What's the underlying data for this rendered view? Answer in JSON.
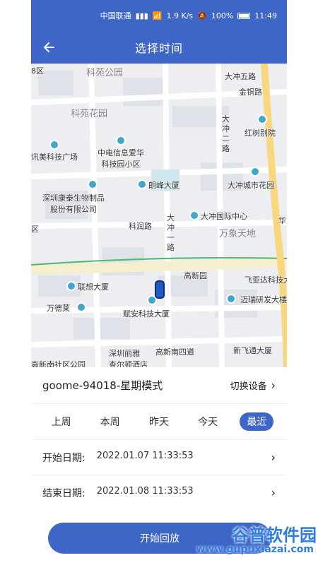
{
  "statusbar": {
    "carrier": "中国联通",
    "speed": "1.9 K/s",
    "battery": "100%",
    "time": "11:49"
  },
  "appbar": {
    "title": "选择时间"
  },
  "map": {
    "labels": {
      "keyuan_park": "科苑公园",
      "dachong5": "大冲五路",
      "jintong": "金铜路",
      "keyuan_garden": "科苑花园",
      "dachong2": "大冲二路",
      "honshu": "红树别院",
      "xunmei": "讯美科技广场",
      "zhongdian": "中电信息爱华\n科技园小区",
      "langfeng": "朗峰大厦",
      "dachong_city": "大冲城市花园",
      "kangtai": "深圳康泰生物制品\n股份有限公司",
      "dachong_intl": "大冲国际中心",
      "kerun": "科润路",
      "dachong1": "大冲一路",
      "wanxiang": "万象天地",
      "gaoxinyuan": "高新园",
      "lenovo": "联想大厦",
      "feiyada": "飞亚达科技大",
      "wandelai": "万德莱",
      "fuan": "赋安科技大厦",
      "maixun": "迈瑞研发大楼",
      "shenzhen_liya": "深圳丽雅\n查尔顿酒店",
      "gaoxin4": "高新南四道",
      "xinfeitong": "新飞通大厦",
      "gaoxin_south": "高新南社区公园",
      "edge_top_left": "8区",
      "edge_mid_left": "区",
      "edge_hua": "华"
    }
  },
  "device": {
    "name": "goome-94018-星期模式",
    "switch_label": "切换设备"
  },
  "tabs": [
    {
      "label": "上周"
    },
    {
      "label": "本周"
    },
    {
      "label": "昨天"
    },
    {
      "label": "今天"
    },
    {
      "label": "最近"
    }
  ],
  "dates": {
    "start_label": "开始日期:",
    "start_value": "2022.01.07 11:33:53",
    "end_label": "结束日期:",
    "end_value": "2022.01.08 11:33:53"
  },
  "cta": {
    "label": "开始回放"
  },
  "watermark": {
    "text": "谷普软件园",
    "url": "www.gupuxiazai.com"
  },
  "colors": {
    "primary": "#3e66c7",
    "road_green": "#4fb870",
    "poi": "#3fa7c8"
  }
}
